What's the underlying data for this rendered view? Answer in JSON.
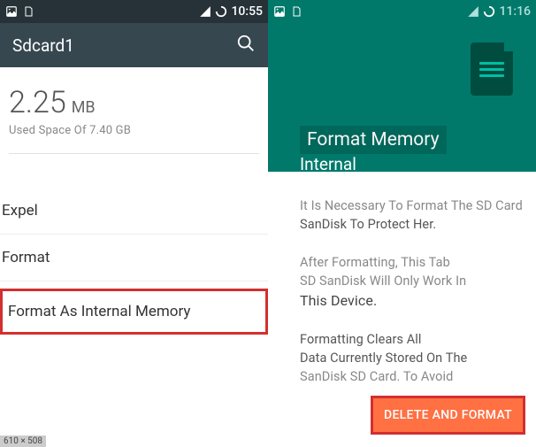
{
  "left": {
    "status": {
      "time": "10:55"
    },
    "header": {
      "title": "Sdcard1"
    },
    "storage": {
      "size": "2.25",
      "unit": "MB",
      "used": "Used Space Of 7.40 GB"
    },
    "menu": {
      "expel": "Expel",
      "format": "Format",
      "format_internal": "Format As Internal Memory"
    }
  },
  "right": {
    "status": {
      "time": "11:16"
    },
    "header": {
      "title": "Format Memory",
      "subtitle": "Internal"
    },
    "body": {
      "p1a": "It Is Necessary To Format The SD Card",
      "p1b": "SanDisk To Protect Her.",
      "p2a": "After Formatting, This Tab",
      "p2b": "SD SanDisk Will Only Work In",
      "p2c": "This Device.",
      "p3a": "Formatting Clears All",
      "p3b": "Data Currently Stored On The",
      "p3c": "SanDisk SD Card. To Avoid"
    },
    "action": "DELETE AND FORMAT"
  },
  "meta": {
    "dim": "610 × 508"
  }
}
